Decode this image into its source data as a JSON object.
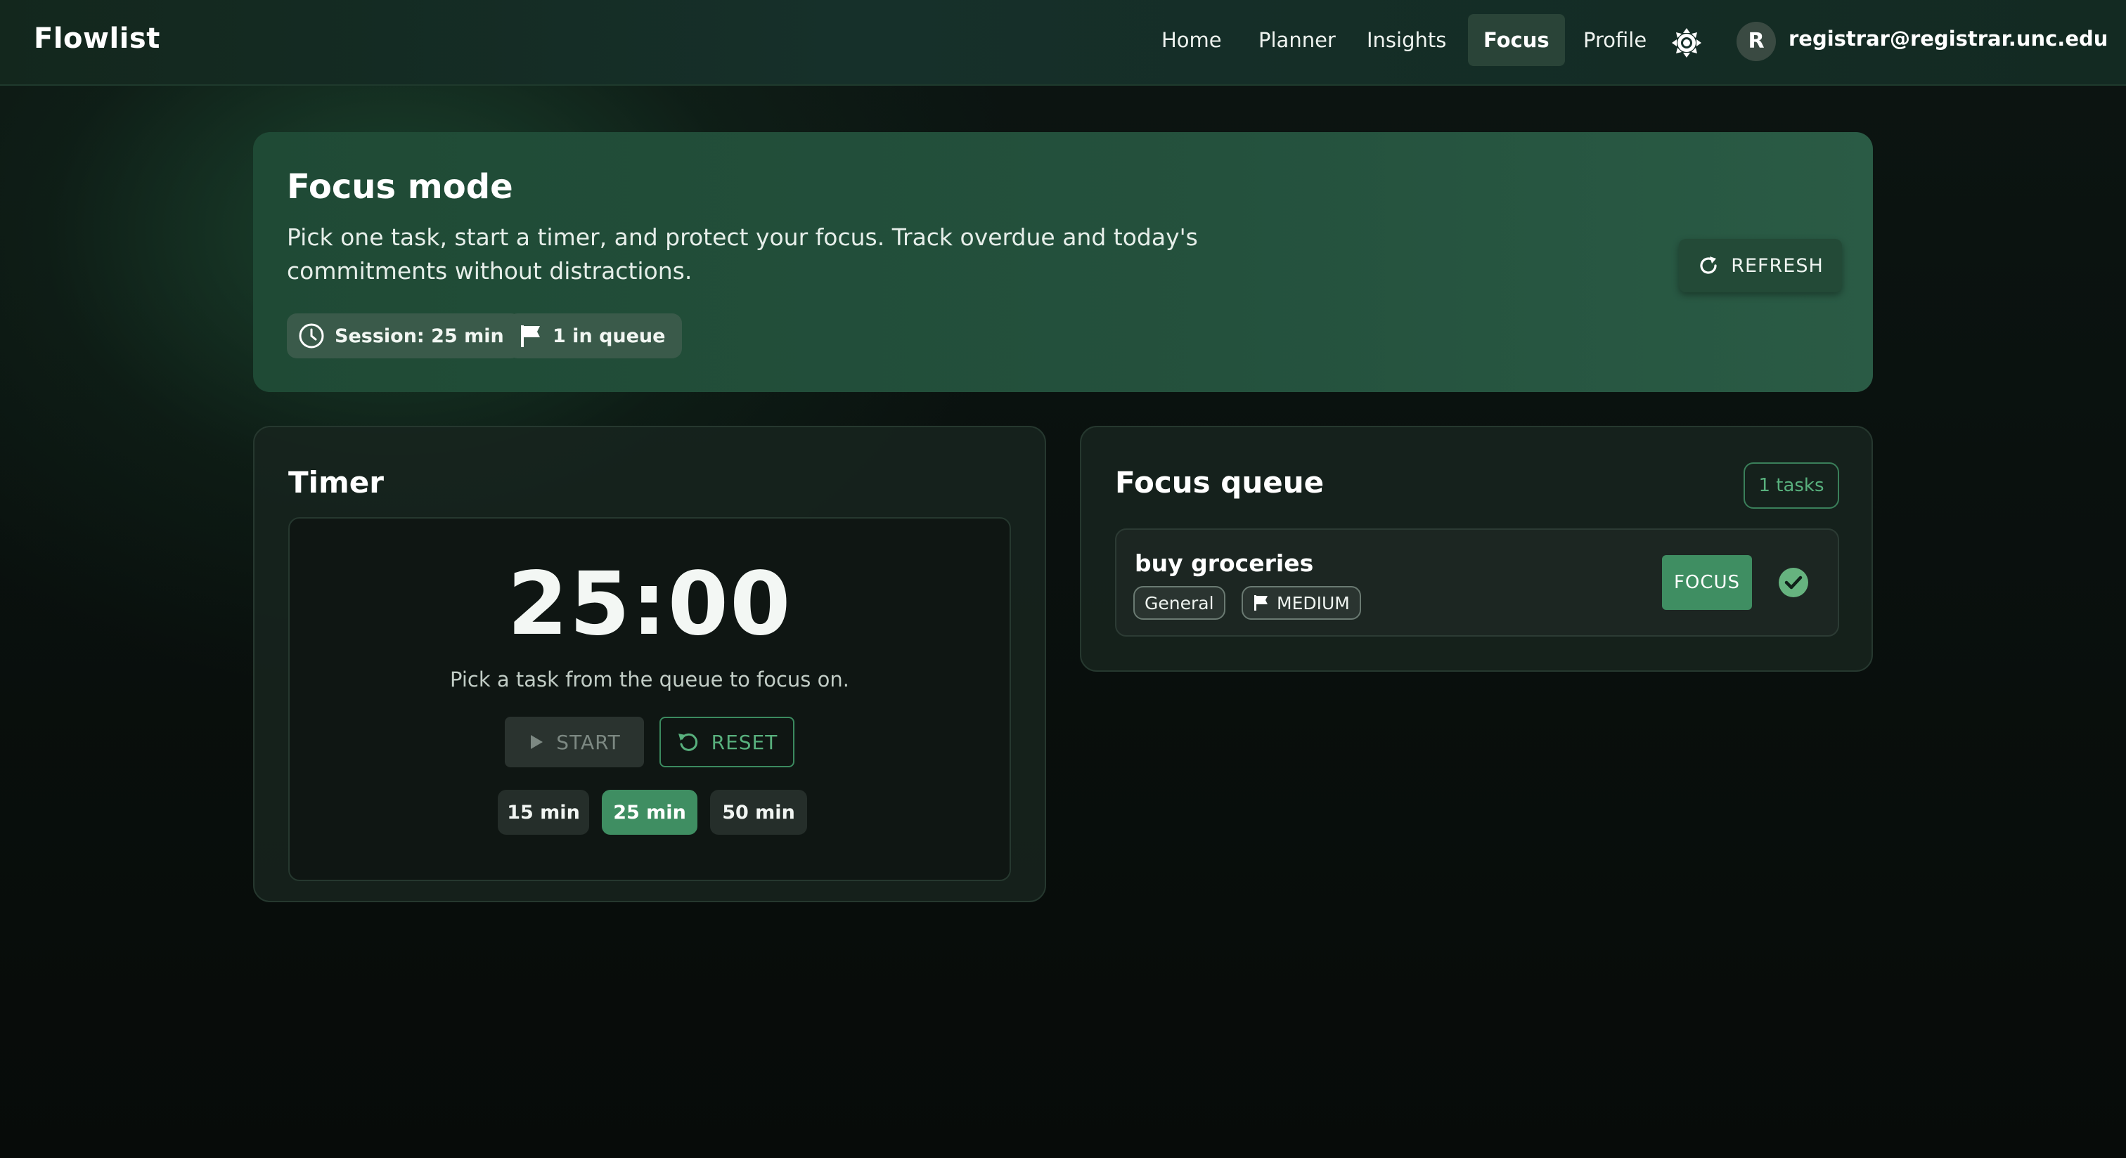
{
  "app": {
    "brand": "Flowlist"
  },
  "nav": {
    "items": [
      {
        "label": "Home",
        "active": false
      },
      {
        "label": "Planner",
        "active": false
      },
      {
        "label": "Insights",
        "active": false
      },
      {
        "label": "Focus",
        "active": true
      },
      {
        "label": "Profile",
        "active": false
      }
    ],
    "theme_icon": "sun-icon",
    "user": {
      "initial": "R",
      "email": "registrar@registrar.unc.edu"
    }
  },
  "hero": {
    "title": "Focus mode",
    "description": "Pick one task, start a timer, and protect your focus. Track overdue and today's commitments without distractions.",
    "chips": [
      {
        "icon": "clock-icon",
        "label": "Session: 25 min"
      },
      {
        "icon": "flag-icon",
        "label": "1 in queue"
      }
    ],
    "refresh_label": "REFRESH"
  },
  "timer": {
    "title": "Timer",
    "display": "25:00",
    "hint": "Pick a task from the queue to focus on.",
    "start_label": "START",
    "start_disabled": true,
    "reset_label": "RESET",
    "durations": [
      {
        "label": "15 min",
        "active": false
      },
      {
        "label": "25 min",
        "active": true
      },
      {
        "label": "50 min",
        "active": false
      }
    ]
  },
  "queue": {
    "title": "Focus queue",
    "count_badge": "1 tasks",
    "items": [
      {
        "title": "buy groceries",
        "category": "General",
        "priority": "MEDIUM",
        "focus_label": "FOCUS",
        "complete_icon": "check-circle-icon"
      }
    ]
  },
  "colors": {
    "accent": "#3f8e62",
    "accent_text": "#58b07d",
    "hero_bg": "#24513d",
    "card_bg": "#18241f"
  }
}
